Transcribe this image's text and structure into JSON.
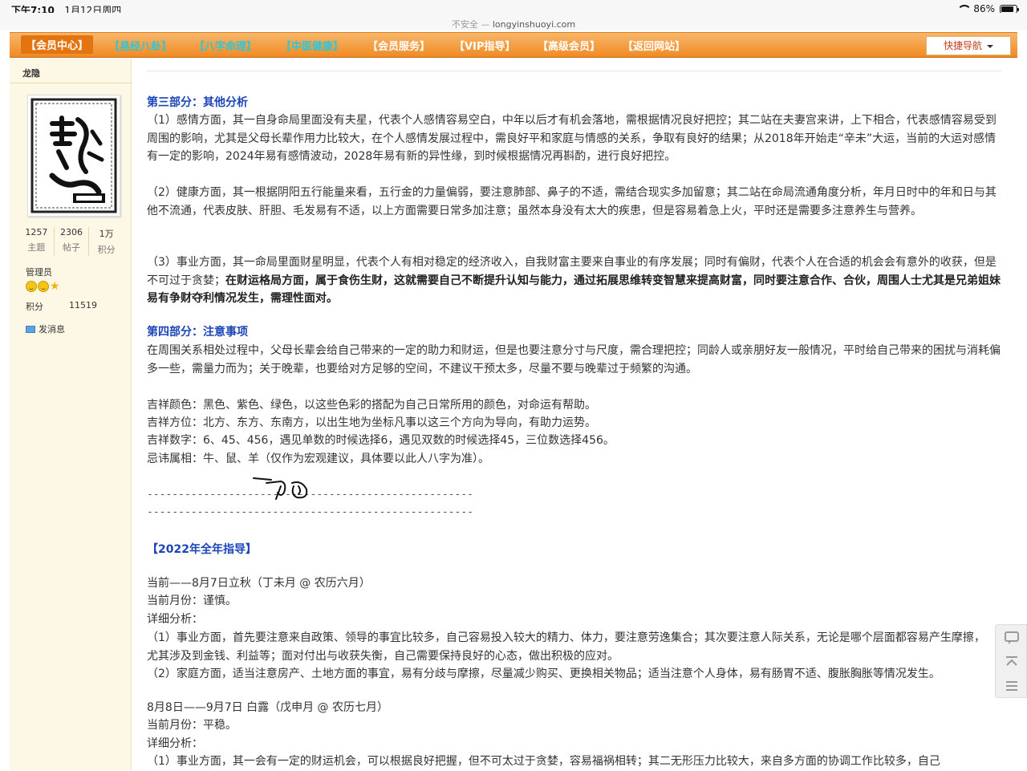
{
  "status_bar": {
    "time": "下午7:10",
    "date": "1月12日周四",
    "battery": "86%",
    "battery_level": 0.86
  },
  "url_bar": {
    "insecure": "不安全 —",
    "domain": "longyinshuoyi.com"
  },
  "nav": {
    "items": [
      "【会员中心】",
      "【易经八卦】",
      "【八字命理】",
      "【中医健康】",
      "【会员服务】",
      "【VIP指导】",
      "【高级会员】",
      "【返回网站】"
    ],
    "item_colors": [
      "#ffffff",
      "#2ec7d8",
      "#2ec7d8",
      "#2ec7d8",
      "#ffffff",
      "#ffffff",
      "#ffffff",
      "#ffffff"
    ],
    "quick_nav": "快捷导航"
  },
  "sidebar": {
    "username": "龙隐",
    "stats": [
      {
        "value": "1257",
        "label": "主题"
      },
      {
        "value": "2306",
        "label": "帖子"
      },
      {
        "value": "1万",
        "label": "积分"
      }
    ],
    "role": "管理员",
    "score_label": "积分",
    "score_value": "11519",
    "message": "发消息"
  },
  "content": {
    "part3_title": "第三部分：其他分析",
    "p1": "（1）感情方面，其一自身命局里面没有夫星，代表个人感情容易空白，中年以后才有机会落地，需根据情况良好把控；其二站在夫妻宫来讲，上下相合，代表感情容易受到周围的影响，尤其是父母长辈作用力比较大，在个人感情发展过程中，需良好平和家庭与情感的关系，争取有良好的结果；从2018年开始走“辛未”大运，当前的大运对感情有一定的影响，2024年易有感情波动，2028年易有新的异性缘，到时候根据情况再斟酌，进行良好把控。",
    "p2": "（2）健康方面，其一根据阴阳五行能量来看，五行金的力量偏弱，要注意肺部、鼻子的不适，需结合现实多加留意；其二站在命局流通角度分析，年月日时中的年和日与其他不流通，代表皮肤、肝胆、毛发易有不适，以上方面需要日常多加注意；虽然本身没有太大的疾患，但是容易着急上火，平时还是需要多注意养生与营养。",
    "p3a": "（3）事业方面，其一命局里面财星明显，代表个人有相对稳定的经济收入，自我财富主要来自事业的有序发展；同时有偏财，代表个人在合适的机会会有意外的收获，但是不可过于贪婪；",
    "p3b": "在财运格局方面，属于食伤生财，这就需要自己不断提升认知与能力，通过拓展思维转变智慧来提高财富，同时要注意合作、合伙，周围人士尤其是兄弟姐妹易有争财夺利情况发生，需理性面对。",
    "part4_title": "第四部分：注意事项",
    "p4": "在周围关系相处过程中，父母长辈会给自己带来的一定的助力和财运，但是也要注意分寸与尺度，需合理把控；同龄人或亲朋好友一般情况，平时给自己带来的困扰与消耗偏多一些，需量力而为；关于晚辈，也要给对方足够的空间，不建议干预太多，尽量不要与晚辈过于频繁的沟通。",
    "lucky_color": "吉祥颜色：黑色、紫色、绿色，以这些色彩的搭配为自己日常所用的颜色，对命运有帮助。",
    "lucky_direction": "吉祥方位：北方、东方、东南方，以出生地为坐标凡事以这三个方向为导向，有助力运势。",
    "lucky_number": "吉祥数字：6、45、456，遇见单数的时候选择6，遇见双数的时候选择45，三位数选择456。",
    "taboo_zodiac": "忌讳属相：牛、鼠、羊（仅作为宏观建议，具体要以此人八字为准）。",
    "dash_line": "----------------------------------------------------",
    "year_title": "【2022年全年指导】",
    "m1_range": "当前——8月7日立秋（丁未月 @ 农历六月）",
    "m1_fortune": "当前月份：谨慎。",
    "m1_label": "详细分析：",
    "m1_p1": "（1）事业方面，首先要注意来自政策、领导的事宜比较多，自己容易投入较大的精力、体力，要注意劳逸集合；其次要注意人际关系，无论是哪个层面都容易产生摩擦，尤其涉及到金钱、利益等；面对付出与收获失衡，自己需要保持良好的心态，做出积极的应对。",
    "m1_p2": "（2）家庭方面，适当注意房产、土地方面的事宜，易有分歧与摩擦，尽量减少购买、更换相关物品；适当注意个人身体，易有肠胃不适、腹胀胸胀等情况发生。",
    "m2_range": "8月8日——9月7日 白露（戊申月 @ 农历七月）",
    "m2_fortune": "当前月份：平稳。",
    "m2_label": "详细分析：",
    "m2_p1": "（1）事业方面，其一会有一定的财运机会，可以根据良好把握，但不可太过于贪婪，容易福祸相转；其二无形压力比较大，来自多方面的协调工作比较多，自己"
  },
  "tools": [
    "comment-icon",
    "back-to-top-icon",
    "list-icon"
  ]
}
